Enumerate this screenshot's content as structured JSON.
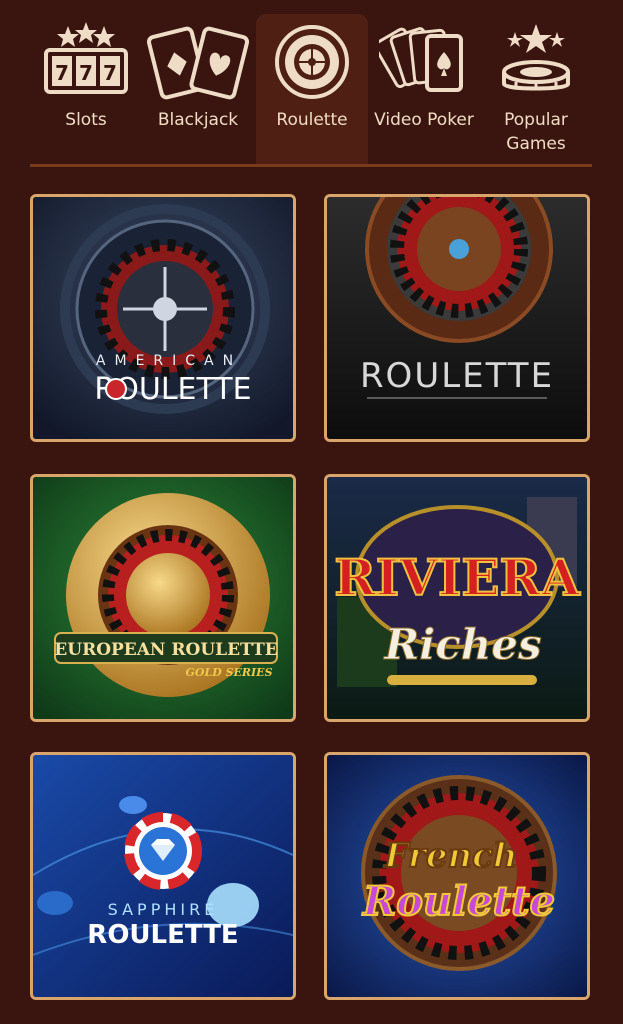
{
  "tabs": [
    {
      "label": "Slots",
      "icon": "slot-machine-icon",
      "active": false
    },
    {
      "label": "Blackjack",
      "icon": "playing-cards-icon",
      "active": false
    },
    {
      "label": "Roulette",
      "icon": "roulette-wheel-icon",
      "active": true
    },
    {
      "label": "Video Poker",
      "icon": "poker-cards-icon",
      "active": false
    },
    {
      "label": "Popular\nGames",
      "icon": "stars-chips-icon",
      "active": false
    }
  ],
  "games": [
    {
      "title_small": "AMERICAN",
      "title": "ROULETTE"
    },
    {
      "title": "ROULETTE"
    },
    {
      "title": "EUROPEAN ROULETTE",
      "subtitle": "GOLD SERIES"
    },
    {
      "title": "RIVIERA",
      "subtitle": "Riches"
    },
    {
      "title_small": "SAPPHIRE",
      "title": "ROULETTE"
    },
    {
      "title": "French",
      "subtitle": "Roulette"
    }
  ],
  "colors": {
    "background": "#3a1510",
    "tab_active": "#4e1f12",
    "tile_border": "#d9a56a",
    "tab_text": "#f1dcc4"
  }
}
